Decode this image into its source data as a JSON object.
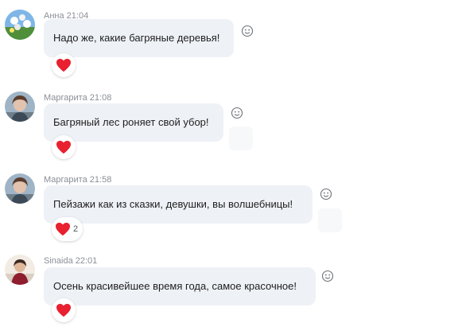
{
  "messages": [
    {
      "author": "Анна",
      "time": "21:04",
      "text": "Надо же, какие багряные деревья!",
      "reaction_icon": "heart-icon",
      "reaction_count": ""
    },
    {
      "author": "Маргарита",
      "time": "21:08",
      "text": "Багряный лес роняет свой убор!",
      "reaction_icon": "heart-icon",
      "reaction_count": ""
    },
    {
      "author": "Маргарита",
      "time": "21:58",
      "text": "Пейзажи как из сказки, девушки, вы волшебницы!",
      "reaction_icon": "heart-icon",
      "reaction_count": "2"
    },
    {
      "author": "Sinaida",
      "time": "22:01",
      "text": "Осень красивейшее время года, самое красочное!",
      "reaction_icon": "heart-icon",
      "reaction_count": ""
    }
  ],
  "icons": {
    "reaction": "heart-icon",
    "add_reaction": "smiley-icon"
  },
  "colors": {
    "bubble": "#eef1f6",
    "heart": "#e8202f",
    "meta_text": "#8a8f96"
  }
}
